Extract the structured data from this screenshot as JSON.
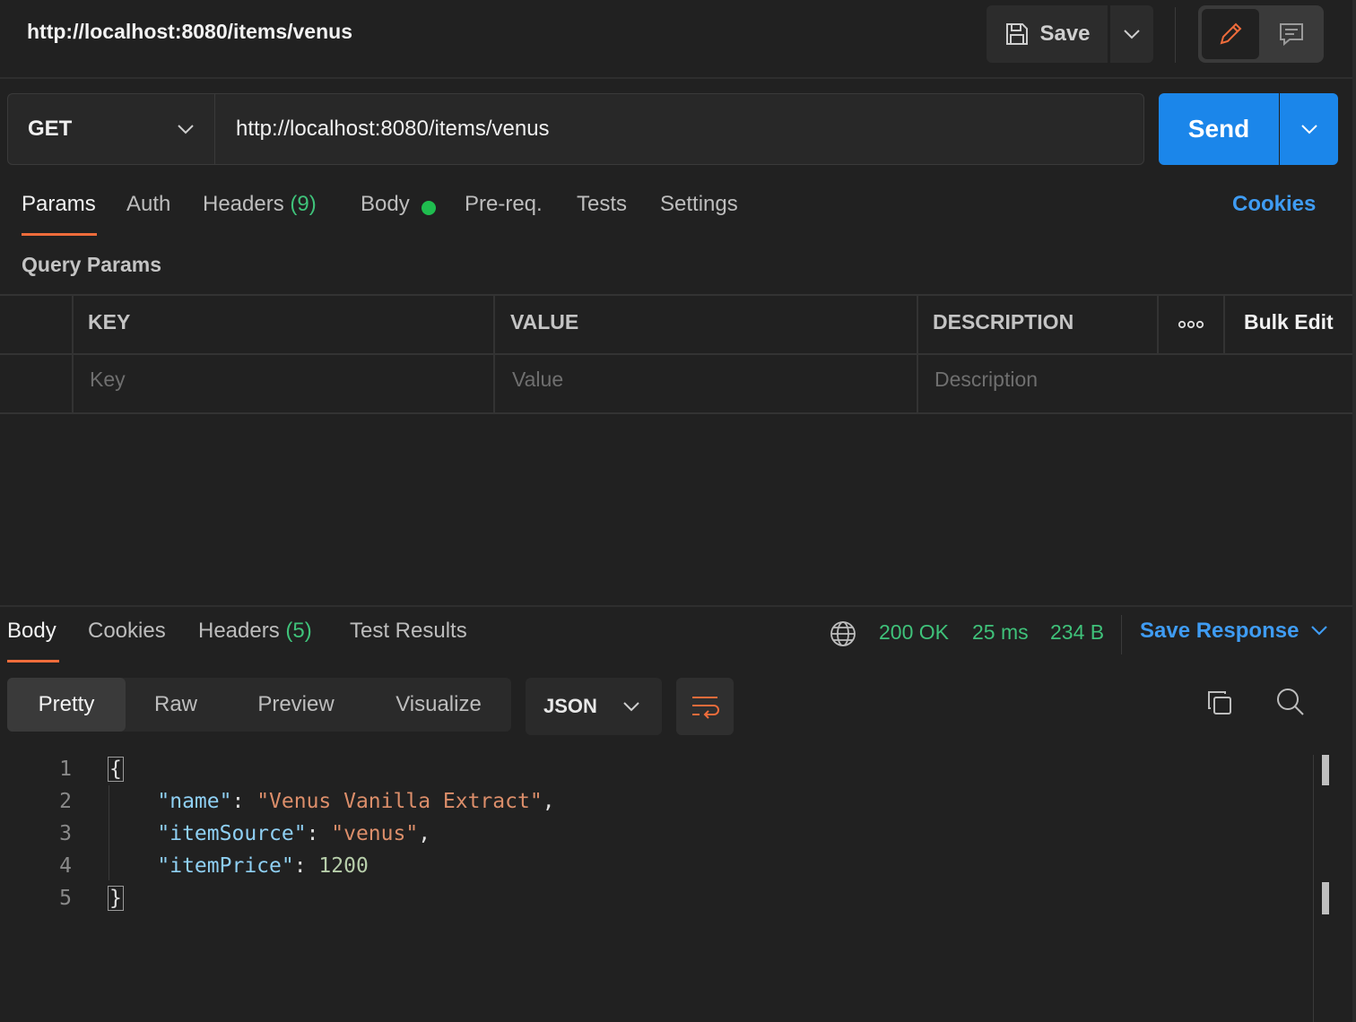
{
  "title": "http://localhost:8080/items/venus",
  "toolbar": {
    "save_label": "Save"
  },
  "request": {
    "method": "GET",
    "url": "http://localhost:8080/items/venus",
    "send_label": "Send"
  },
  "request_tabs": {
    "params": "Params",
    "auth": "Auth",
    "headers": "Headers",
    "headers_count": "(9)",
    "body": "Body",
    "prereq": "Pre-req.",
    "tests": "Tests",
    "settings": "Settings",
    "cookies": "Cookies"
  },
  "query_params": {
    "title": "Query Params",
    "columns": {
      "key": "KEY",
      "value": "VALUE",
      "description": "DESCRIPTION"
    },
    "more_label": "ooo",
    "bulk_edit": "Bulk Edit",
    "placeholders": {
      "key": "Key",
      "value": "Value",
      "description": "Description"
    }
  },
  "response": {
    "tabs": {
      "body": "Body",
      "cookies": "Cookies",
      "headers": "Headers",
      "headers_count": "(5)",
      "test_results": "Test Results"
    },
    "status": "200 OK",
    "time": "25 ms",
    "size": "234 B",
    "save_response": "Save Response",
    "views": {
      "pretty": "Pretty",
      "raw": "Raw",
      "preview": "Preview",
      "visualize": "Visualize"
    },
    "format": "JSON",
    "line_numbers": [
      "1",
      "2",
      "3",
      "4",
      "5"
    ],
    "json": {
      "open": "{",
      "close": "}",
      "name_key": "\"name\"",
      "name_value": "\"Venus Vanilla Extract\"",
      "source_key": "\"itemSource\"",
      "source_value": "\"venus\"",
      "price_key": "\"itemPrice\"",
      "price_value": "1200"
    }
  },
  "icons": {
    "save": "save-icon",
    "chevron": "chevron-down-icon",
    "edit": "pencil-icon",
    "comment": "comment-icon",
    "globe": "globe-icon",
    "wrap": "wrap-lines-icon",
    "copy": "copy-icon",
    "search": "search-icon"
  },
  "colors": {
    "accent_orange": "#ef6c3b",
    "send_blue": "#1b86ea",
    "link_blue": "#3f9cf3",
    "success_green": "#3fc27a"
  }
}
